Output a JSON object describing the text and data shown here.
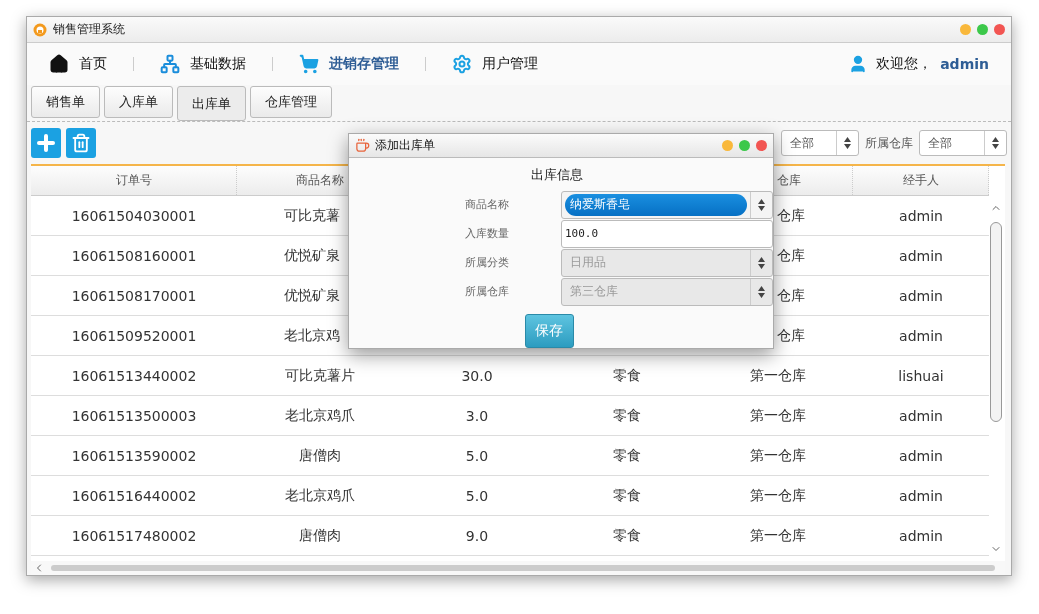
{
  "window": {
    "title": "销售管理系统"
  },
  "nav": [
    {
      "label": "首页",
      "selected": false
    },
    {
      "label": "基础数据",
      "selected": false
    },
    {
      "label": "进销存管理",
      "selected": true
    },
    {
      "label": "用户管理",
      "selected": false
    }
  ],
  "user": {
    "greeting": "欢迎您，",
    "name": "admin"
  },
  "tabs": [
    {
      "label": "销售单",
      "selected": false
    },
    {
      "label": "入库单",
      "selected": false
    },
    {
      "label": "出库单",
      "selected": true
    },
    {
      "label": "仓库管理",
      "selected": false
    }
  ],
  "toolbar": {
    "buttons": [
      {
        "kind": "add"
      },
      {
        "kind": "delete"
      }
    ]
  },
  "filters": [
    {
      "kind": "select",
      "value": "全部"
    },
    {
      "kind": "label",
      "text": "所属仓库"
    },
    {
      "kind": "select",
      "value": "全部"
    }
  ],
  "table": {
    "columns": [
      "订单号",
      "商品名称",
      null,
      null,
      "仓库",
      "经手人"
    ],
    "rows": [
      [
        "16061504030001",
        "可比克薯",
        null,
        null,
        "仓库",
        "admin"
      ],
      [
        "16061508160001",
        "优悦矿泉",
        null,
        null,
        "仓库",
        "admin"
      ],
      [
        "16061508170001",
        "优悦矿泉",
        null,
        null,
        "仓库",
        "admin"
      ],
      [
        "16061509520001",
        "老北京鸡",
        null,
        null,
        "仓库",
        "admin"
      ],
      [
        "16061513440002",
        "可比克薯片",
        "30.0",
        "零食",
        "第一仓库",
        "lishuai"
      ],
      [
        "16061513500003",
        "老北京鸡爪",
        "3.0",
        "零食",
        "第一仓库",
        "admin"
      ],
      [
        "16061513590002",
        "唐僧肉",
        "5.0",
        "零食",
        "第一仓库",
        "admin"
      ],
      [
        "16061516440002",
        "老北京鸡爪",
        "5.0",
        "零食",
        "第一仓库",
        "admin"
      ],
      [
        "16061517480002",
        "唐僧肉",
        "9.0",
        "零食",
        "第一仓库",
        "admin"
      ]
    ]
  },
  "dialog": {
    "title": "添加出库单",
    "heading": "出库信息",
    "fields": [
      {
        "label": "商品名称",
        "kind": "select",
        "value": "纳爱斯香皂",
        "focused": true,
        "disabled": false
      },
      {
        "label": "入库数量",
        "kind": "input",
        "value": "100.0",
        "focused": false,
        "disabled": false
      },
      {
        "label": "所属分类",
        "kind": "select",
        "value": "日用品",
        "focused": false,
        "disabled": true
      },
      {
        "label": "所属仓库",
        "kind": "select",
        "value": "第三仓库",
        "focused": false,
        "disabled": true
      }
    ],
    "button": "保存"
  }
}
